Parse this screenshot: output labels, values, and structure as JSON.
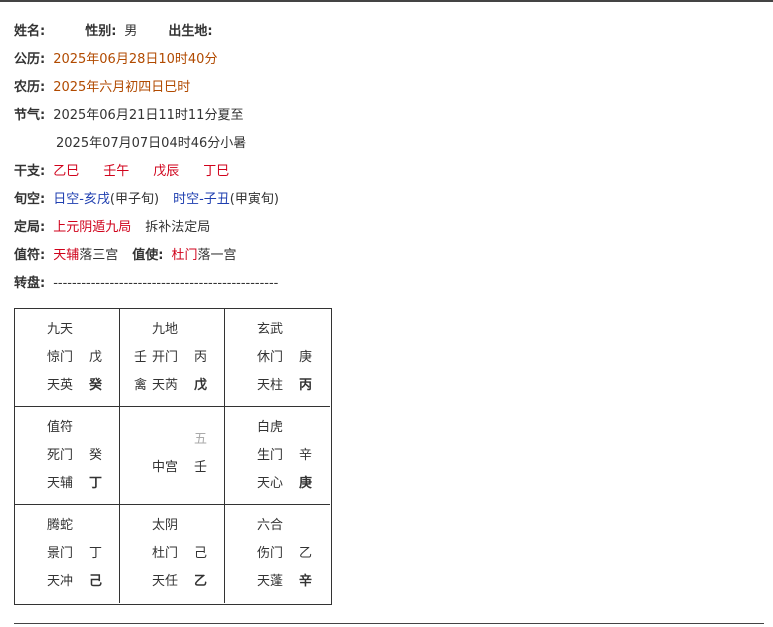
{
  "info": {
    "name_label": "姓名:",
    "gender_label": "性别:",
    "gender_value": "男",
    "birthplace_label": "出生地:",
    "solar_label": "公历:",
    "solar_value": "2025年06月28日10时40分",
    "lunar_label": "农历:",
    "lunar_value": "2025年六月初四日巳时",
    "jieqi_label": "节气:",
    "jieqi_1": "2025年06月21日11时11分夏至",
    "jieqi_2": "2025年07月07日04时46分小暑",
    "ganzhi_label": "干支:",
    "ganzhi": [
      "乙巳",
      "壬午",
      "戊辰",
      "丁巳"
    ],
    "xunkong_label": "旬空:",
    "rikong": "日空-亥戌",
    "rikong_xun": "(甲子旬)",
    "shikong": "时空-子丑",
    "shikong_xun": "(甲寅旬)",
    "dingju_label": "定局:",
    "dingju_value": "上元阴遁九局",
    "dingju_method": "拆补法定局",
    "zhifu_label": "值符:",
    "zhifu_star": "天辅",
    "zhifu_palace": "落三宫",
    "zhishi_label": "值使:",
    "zhishi_door": "杜门",
    "zhishi_palace": "落一宫",
    "zhuanpan_label": "转盘:",
    "zhuanpan_dash": "------------------------------------------------"
  },
  "grid": {
    "cells": [
      {
        "god": "九天",
        "door": "惊门",
        "door_stem": "戊",
        "star": "天英",
        "star_stem": "癸"
      },
      {
        "god": "九地",
        "pre_door": "壬",
        "door": "开门",
        "door_stem": "丙",
        "pre_star": "禽",
        "star": "天芮",
        "star_stem": "戊"
      },
      {
        "god": "玄武",
        "door": "休门",
        "door_stem": "庚",
        "star": "天柱",
        "star_stem": "丙"
      },
      {
        "god": "值符",
        "door": "死门",
        "door_stem": "癸",
        "star": "天辅",
        "star_stem": "丁"
      },
      {
        "center_number": "五",
        "center_name": "中宫",
        "center_stem": "壬"
      },
      {
        "god": "白虎",
        "door": "生门",
        "door_stem": "辛",
        "star": "天心",
        "star_stem": "庚"
      },
      {
        "god": "腾蛇",
        "door": "景门",
        "door_stem": "丁",
        "star": "天冲",
        "star_stem": "己"
      },
      {
        "god": "太阴",
        "door": "杜门",
        "door_stem": "己",
        "star": "天任",
        "star_stem": "乙"
      },
      {
        "god": "六合",
        "door": "伤门",
        "door_stem": "乙",
        "star": "天蓬",
        "star_stem": "辛"
      }
    ]
  }
}
